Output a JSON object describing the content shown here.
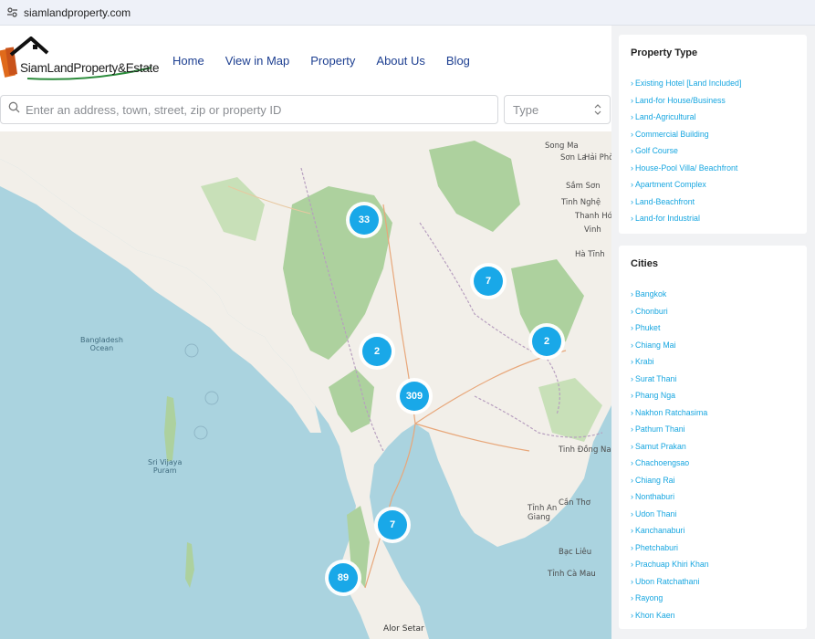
{
  "browser": {
    "url": "siamlandproperty.com"
  },
  "header": {
    "logo_text": "SiamLandProperty&Estate",
    "nav": [
      "Home",
      "View in Map",
      "Property",
      "About Us",
      "Blog"
    ]
  },
  "search": {
    "placeholder": "Enter an address, town, street, zip or property ID",
    "type_placeholder": "Type"
  },
  "map": {
    "clusters": [
      "33",
      "7",
      "2",
      "2",
      "309",
      "7",
      "89"
    ],
    "labels": {
      "bangladesh": "Bangladesh\nOcean",
      "sri_vijaya": "Sri Vijaya\nPuram",
      "alor_setar": "Alor Setar",
      "song_ma": "Song Ma",
      "son_la": "Sơn La",
      "hai_phong": "Hải Phò",
      "sam_son": "Sầm Sơn",
      "tinh_nghe": "Tinh Nghệ",
      "thanh_hoa": "Thanh Hóa",
      "vinh": "Vinh",
      "ha_tinh": "Hà Tĩnh",
      "bac_lieu": "Bạc Liêu",
      "can_tho": "Cần Thơ",
      "tinh_an_giang": "Tỉnh An\nGiang",
      "tinh_ca_mau": "Tỉnh Cà Mau",
      "tinh_dong_nai": "Tinh Đồng Nai"
    },
    "colors": {
      "sea": "#aad3df",
      "land": "#f2efe9",
      "forest": "#add19e",
      "cluster": "#19a8e8"
    }
  },
  "sidebar": {
    "property_type": {
      "title": "Property Type",
      "items": [
        "Existing Hotel [Land Included]",
        "Land-for House/Business",
        "Land-Agricultural",
        "Commercial Building",
        "Golf Course",
        "House-Pool Villa/ Beachfront",
        "Apartment Complex",
        "Land-Beachfront",
        "Land-for Industrial"
      ]
    },
    "cities": {
      "title": "Cities",
      "items": [
        "Bangkok",
        "Chonburi",
        "Phuket",
        "Chiang Mai",
        "Krabi",
        "Surat Thani",
        "Phang Nga",
        "Nakhon Ratchasima",
        "Pathum Thani",
        "Samut Prakan",
        "Chachoengsao",
        "Chiang Rai",
        "Nonthaburi",
        "Udon Thani",
        "Kanchanaburi",
        "Phetchaburi",
        "Prachuap Khiri Khan",
        "Ubon Ratchathani",
        "Rayong",
        "Khon Kaen"
      ]
    }
  }
}
